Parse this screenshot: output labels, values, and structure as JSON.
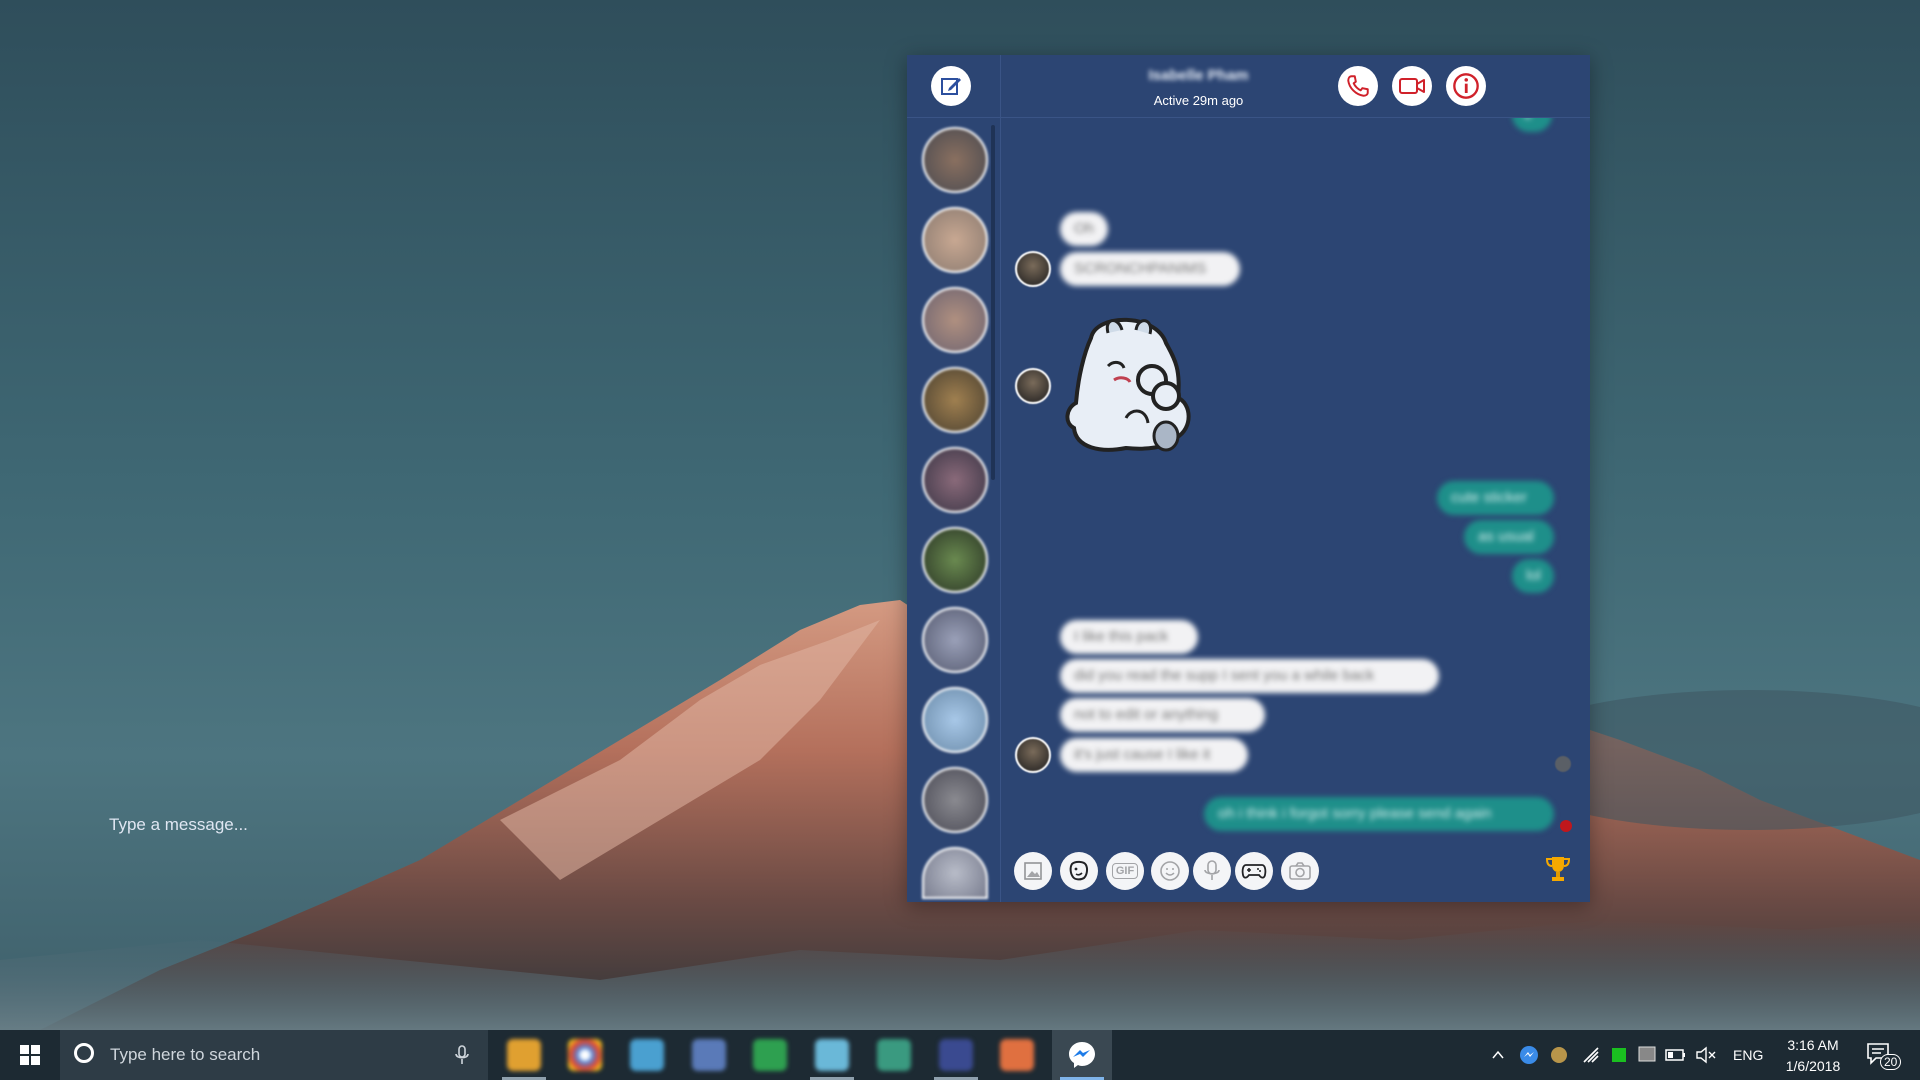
{
  "messenger": {
    "header": {
      "contact_name": "Isabelle Pham",
      "status": "Active 29m ago"
    },
    "messages": [
      {
        "from": "them",
        "text": "Oh"
      },
      {
        "from": "them",
        "text": "SCRONCHPANIMS"
      },
      {
        "from": "me",
        "text": "cute sticker"
      },
      {
        "from": "me",
        "text": "as usual"
      },
      {
        "from": "me",
        "text": "lol"
      },
      {
        "from": "them",
        "text": "I like this pack"
      },
      {
        "from": "them",
        "text": "did you read the supp I sent you a while back"
      },
      {
        "from": "them",
        "text": "not to edit or anything"
      },
      {
        "from": "them",
        "text": "it's just cause I like it"
      },
      {
        "from": "me",
        "text": "oh i think i forgot sorry please send again"
      }
    ],
    "partial_top_bubble": "d",
    "composer": {
      "placeholder": "Type a message..."
    },
    "tools": [
      "image-icon",
      "sticker-icon",
      "gif-icon",
      "emoji-icon",
      "microphone-icon",
      "game-controller-icon",
      "camera-icon"
    ],
    "gif_label": "GIF",
    "accent_colors": {
      "window": "#2c4573",
      "outgoing": "#1e8f8a",
      "incoming": "#f2f2f4",
      "call_icons": "#d0212a"
    }
  },
  "taskbar": {
    "search_placeholder": "Type here to search",
    "language": "ENG",
    "time": "3:16 AM",
    "date": "1/6/2018",
    "notification_count": "20"
  }
}
